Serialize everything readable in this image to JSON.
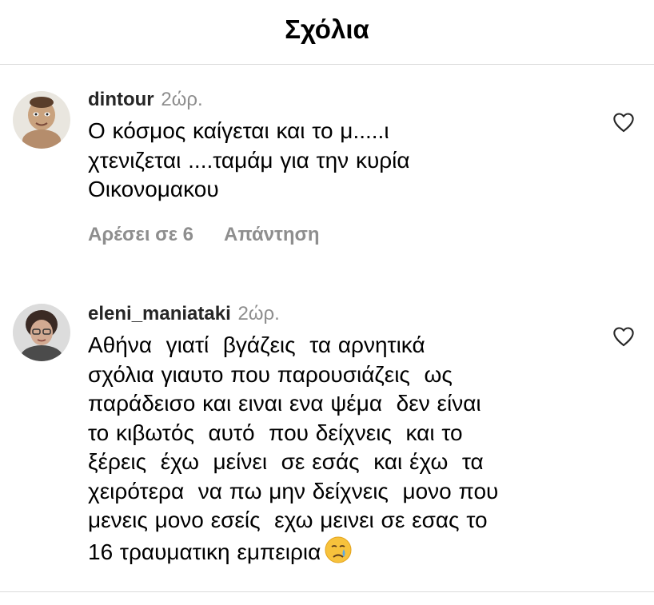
{
  "header": {
    "title": "Σχόλια"
  },
  "comments": [
    {
      "username": "dintour",
      "time": "2ώρ.",
      "text": "Ο κόσμος καίγεται και το μ.....ι\nχτενιζεται ....ταμάμ για την κυρία\nΟικονομακου",
      "likes_label": "Αρέσει σε 6",
      "reply_label": "Απάντηση"
    },
    {
      "username": "eleni_maniataki",
      "time": "2ώρ.",
      "text": "Αθήνα  γιατί  βγάζεις  τα αρνητικά\nσχόλια γιαυτο που παρουσιάζεις  ως\nπαράδεισο και ειναι ενα ψέμα  δεν είναι\nτο κιβωτός  αυτό  που δείχνεις  και το\nξέρεις  έχω  μείνει  σε εσάς  και έχω  τα\nχειρότερα  να πω μην δείχνεις  μονο που\nμενεις μονο εσείς  εχω μεινει σε εσας το\n16 τραυματικη εμπειρια"
    }
  ],
  "icons": {
    "heart": "heart-outline-icon",
    "emoji": "crying-face-emoji"
  },
  "colors": {
    "secondary_text": "#8e8e8e",
    "divider": "#dbdbdb"
  }
}
